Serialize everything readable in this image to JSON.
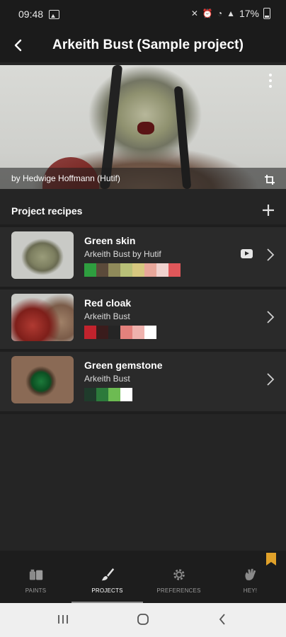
{
  "status_bar": {
    "time": "09:48",
    "battery": "17%",
    "icons": [
      "image-icon",
      "mute-icon",
      "alarm-icon",
      "wifi-icon",
      "signal-icon",
      "battery-icon"
    ]
  },
  "app_bar": {
    "title": "Arkeith Bust (Sample project)"
  },
  "hero": {
    "caption": "by Hedwige Hoffmann (Hutif)"
  },
  "section": {
    "title": "Project recipes"
  },
  "recipes": [
    {
      "title": "Green skin",
      "subtitle": "Arkeith Bust by Hutif",
      "has_video": true,
      "swatches": [
        "#2e9e3f",
        "#5b4a3a",
        "#8f8a5a",
        "#b8c078",
        "#d6c77f",
        "#e8a79a",
        "#f0d2ce",
        "#e0575a"
      ]
    },
    {
      "title": "Red cloak",
      "subtitle": "Arkeith Bust",
      "has_video": false,
      "swatches": [
        "#c2232d",
        "#3a1c1c",
        "#252525",
        "#e4817c",
        "#efb2ad",
        "#ffffff"
      ]
    },
    {
      "title": "Green gemstone",
      "subtitle": "Arkeith Bust",
      "has_video": false,
      "swatches": [
        "#1f3b2b",
        "#2c7a3b",
        "#6dbb52",
        "#ffffff"
      ]
    }
  ],
  "bottom_nav": {
    "items": [
      {
        "label": "PAINTS",
        "icon": "paints-icon",
        "active": false
      },
      {
        "label": "PROJECTS",
        "icon": "brush-icon",
        "active": true
      },
      {
        "label": "PREFERENCES",
        "icon": "gear-icon",
        "active": false
      },
      {
        "label": "HEY!",
        "icon": "hand-wave-icon",
        "active": false
      }
    ]
  },
  "colors": {
    "background": "#252525",
    "bar": "#1b1b1b",
    "row": "#2a2a2a",
    "accent_bookmark": "#e0a12a"
  }
}
